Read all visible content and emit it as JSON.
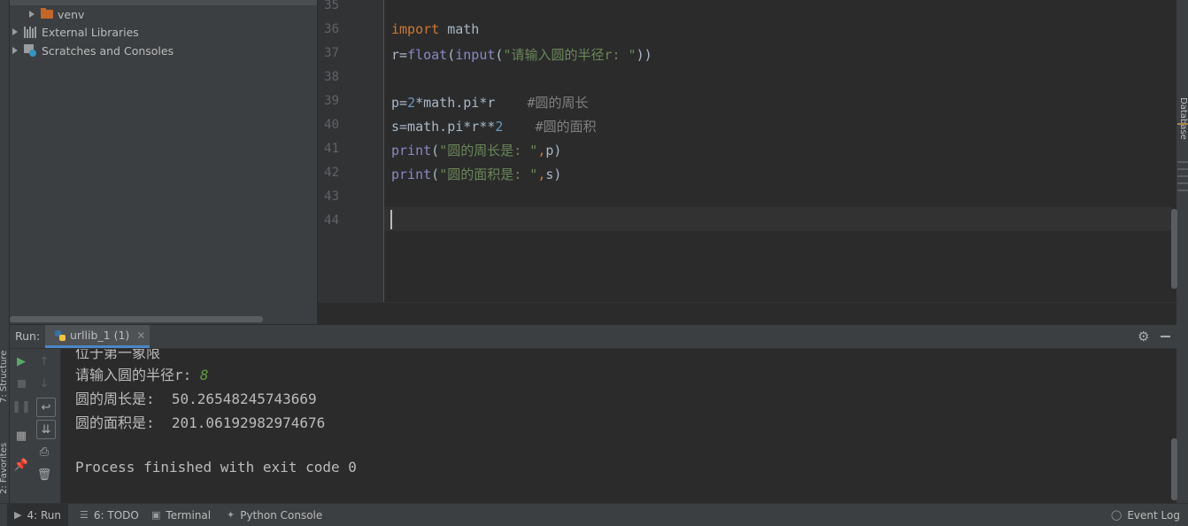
{
  "left_strip": {
    "structure_label": "7: Structure",
    "favorites_label": "2: Favorites"
  },
  "right_strip": {
    "database_label": "Database"
  },
  "project_tree": {
    "items": [
      {
        "label": "venv",
        "icon": "folder-icon"
      },
      {
        "label": "External Libraries",
        "icon": "libraries-icon"
      },
      {
        "label": "Scratches and Consoles",
        "icon": "scratches-icon"
      }
    ]
  },
  "editor": {
    "line_numbers": [
      "35",
      "36",
      "37",
      "38",
      "39",
      "40",
      "41",
      "42",
      "43",
      "44"
    ],
    "lines": {
      "l36": {
        "kw": "import",
        "rest": " math"
      },
      "l37": {
        "a": "r=",
        "fn1": "float",
        "b": "(",
        "fn2": "input",
        "c": "(",
        "s": "\"请输入圆的半径r: \"",
        "d": "))"
      },
      "l39": {
        "a": "p=",
        "n": "2",
        "b": "*math.pi*r    ",
        "cm": "#圆的周长"
      },
      "l40": {
        "a": "s=math.pi*r**",
        "n": "2",
        "b": "    ",
        "cm": "#圆的面积"
      },
      "l41": {
        "fn": "print",
        "a": "(",
        "s": "\"圆的周长是: \"",
        "c": ",",
        "b": "p)"
      },
      "l42": {
        "fn": "print",
        "a": "(",
        "s": "\"圆的面积是: \"",
        "c": ",",
        "b": "s)"
      }
    }
  },
  "run_panel": {
    "title": "Run:",
    "tab_label": "urllib_1 (1)",
    "output": {
      "partial_line": "位于第一象限",
      "prompt": "请输入圆的半径r: ",
      "user_input": "8",
      "perimeter_line": "圆的周长是:  50.26548245743669",
      "area_line": "圆的面积是:  201.06192982974676",
      "exit_line": "Process finished with exit code 0"
    }
  },
  "status_bar": {
    "run": "4: Run",
    "todo": "6: TODO",
    "terminal": "Terminal",
    "python_console": "Python Console",
    "event_log": "Event Log"
  },
  "colors": {
    "keyword": "#cc7832",
    "number": "#6897bb",
    "string": "#6a8759",
    "comment": "#808080",
    "builtin": "#8888c6"
  }
}
